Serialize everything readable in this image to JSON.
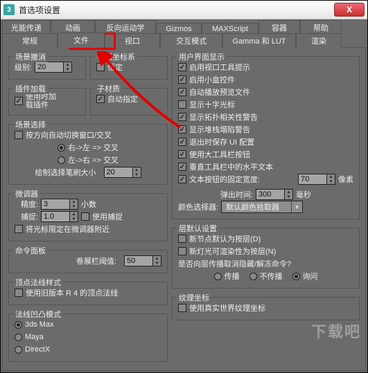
{
  "window": {
    "title": "首选项设置",
    "close": "X",
    "icon": "3"
  },
  "tabs_row1": [
    "光能传递",
    "动画",
    "反向运动学",
    "Gizmos",
    "MAXScript",
    "容器",
    "帮助"
  ],
  "tabs_row1_widths": [
    70,
    64,
    88,
    66,
    82,
    60,
    60
  ],
  "tabs_row2": [
    "常规",
    "文件",
    "视口",
    "交互模式",
    "Gamma 和 LUT",
    "渲染"
  ],
  "tabs_row2_widths": [
    80,
    68,
    80,
    90,
    106,
    66
  ],
  "tabs_row2_active": 1,
  "sceneUndo": {
    "title": "场景撤消",
    "level_label": "级别:",
    "level": "20"
  },
  "refCoord": {
    "title": "参照坐标系",
    "constant": "恒定"
  },
  "pluginLoad": {
    "title": "插件加载",
    "onUse": "使用时加\n载插件"
  },
  "subMat": {
    "title": "子材质",
    "auto": "自动指定"
  },
  "sceneSel": {
    "title": "场景选择",
    "autoSwitch": "按方向自动切换窗口/交叉",
    "rtol": "右->左 => 交叉",
    "ltor": "左->右 => 交叉",
    "brushLabel": "绘制选择笔刷大小",
    "brush": "20"
  },
  "spinners": {
    "title": "微调器",
    "precLabel": "精度:",
    "prec": "3",
    "precUnit": "小数",
    "snapLabel": "捕捉:",
    "snap": "1.0",
    "useSnap": "使用捕捉",
    "lockCursor": "将光标限定在微调器附近"
  },
  "cmdPanel": {
    "title": "命令面板",
    "rollLabel": "卷展栏阈值:",
    "roll": "50"
  },
  "vertNorm": {
    "title": "顶点法线样式",
    "old": "使用旧版本 R 4 的顶点法线"
  },
  "normal": {
    "title": "法线凹凸模式",
    "r1": "3ds Max",
    "r2": "Maya",
    "r3": "DirectX"
  },
  "uiDisplay": {
    "title": "用户界面显示",
    "items": [
      {
        "t": "启用视口工具提示",
        "c": true
      },
      {
        "t": "启用小盒控件",
        "c": true
      },
      {
        "t": "自动播放预览文件",
        "c": true
      },
      {
        "t": "显示十字光标",
        "c": false
      },
      {
        "t": "显示拓扑相关性警告",
        "c": true
      },
      {
        "t": "显示堆栈塌陷警告",
        "c": true
      },
      {
        "t": "退出时保存 UI 配置",
        "c": true
      },
      {
        "t": "使用大工具栏按钮",
        "c": true
      },
      {
        "t": "垂直工具栏中的水平文本",
        "c": true
      },
      {
        "t": "文本按钮的固定宽度:",
        "c": true
      }
    ],
    "fixedW": "70",
    "pxUnit": "像素",
    "flyoutLabel": "弹出时间:",
    "flyout": "300",
    "msUnit": "毫秒",
    "pickerLabel": "颜色选择器:",
    "picker": "默认颜色拾取器"
  },
  "layerDef": {
    "title": "层默认设置",
    "a": "新节点默认为按层(D)",
    "b": "新灯光可渲染性为按层(N)",
    "q": "是否向层传播取消隐藏/解冻命令?",
    "r1": "传播",
    "r2": "不传播",
    "r3": "询问"
  },
  "texCoord": {
    "title": "纹理坐标",
    "a": "使用真实世界纹理坐标"
  },
  "watermark": "下载吧"
}
